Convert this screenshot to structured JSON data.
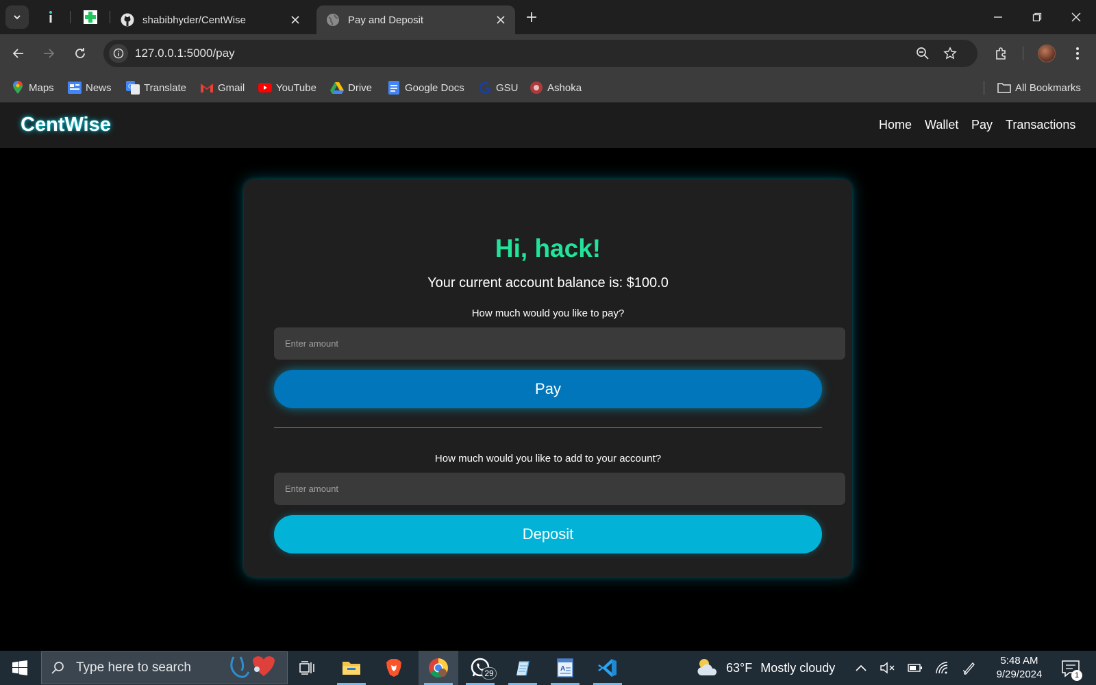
{
  "browser": {
    "tabs": [
      {
        "title": "shabibhyder/CentWise",
        "icon": "github-icon"
      },
      {
        "title": "Pay and Deposit",
        "icon": "globe-icon",
        "active": true
      }
    ],
    "url": "127.0.0.1:5000/pay",
    "bookmarks": [
      "Maps",
      "News",
      "Translate",
      "Gmail",
      "YouTube",
      "Drive",
      "Google Docs",
      "GSU",
      "Ashoka"
    ],
    "all_bookmarks_label": "All Bookmarks"
  },
  "site": {
    "brand": "CentWise",
    "nav": [
      "Home",
      "Wallet",
      "Pay",
      "Transactions"
    ],
    "accent_color": "#22e39a",
    "glow_color": "#00e6ff"
  },
  "card": {
    "greeting": "Hi, hack!",
    "balance_text": "Your current account balance is: $100.0",
    "pay_prompt": "How much would you like to pay?",
    "pay_placeholder": "Enter amount",
    "pay_button": "Pay",
    "deposit_prompt": "How much would you like to add to your account?",
    "deposit_placeholder": "Enter amount",
    "deposit_button": "Deposit",
    "pay_button_color": "#0276bb",
    "deposit_button_color": "#02b3d7"
  },
  "taskbar": {
    "search_placeholder": "Type here to search",
    "whatsapp_badge": "29",
    "weather_temp": "63°F",
    "weather_desc": "Mostly cloudy",
    "time": "5:48 AM",
    "date": "9/29/2024",
    "notifications": "1"
  }
}
